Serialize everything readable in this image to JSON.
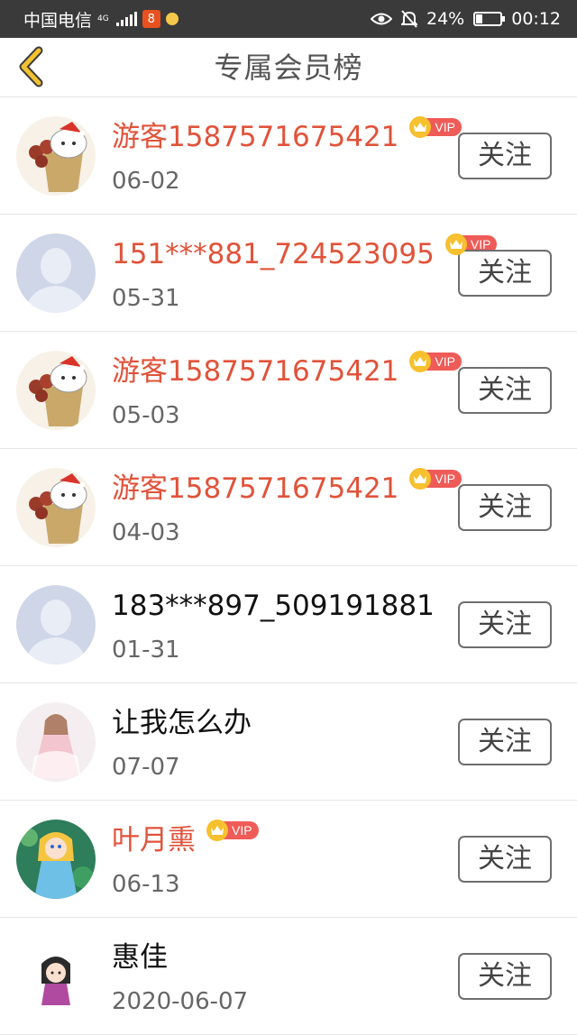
{
  "status_bar": {
    "carrier": "中国电信",
    "network_type": "4G",
    "app_badge_text": "8",
    "battery_percent": "24%",
    "battery_level": 0.24,
    "time": "00:12"
  },
  "header": {
    "title": "专属会员榜",
    "back_icon": "chevron-left-icon",
    "accent_color": "#f2c230"
  },
  "vip_badge_label": "VIP",
  "colors": {
    "vip_name": "#e0533a",
    "vip_badge": "#ef5b57",
    "vip_crown": "#f6c02e"
  },
  "members": [
    {
      "name": "游客1587571675421",
      "date": "06-02",
      "vip": true,
      "avatar": "cat-avatar",
      "follow_label": "关注"
    },
    {
      "name": "151***881_724523095",
      "date": "05-31",
      "vip": true,
      "avatar": "default-avatar",
      "follow_label": "关注"
    },
    {
      "name": "游客1587571675421",
      "date": "05-03",
      "vip": true,
      "avatar": "cat-avatar",
      "follow_label": "关注"
    },
    {
      "name": "游客1587571675421",
      "date": "04-03",
      "vip": true,
      "avatar": "cat-avatar",
      "follow_label": "关注"
    },
    {
      "name": "183***897_509191881",
      "date": "01-31",
      "vip": false,
      "avatar": "default-avatar",
      "follow_label": "关注"
    },
    {
      "name": "让我怎么办",
      "date": "07-07",
      "vip": false,
      "avatar": "anime-girl-avatar",
      "follow_label": "关注"
    },
    {
      "name": "叶月熏",
      "date": "06-13",
      "vip": true,
      "avatar": "anime-fairy-avatar",
      "follow_label": "关注"
    },
    {
      "name": "惠佳",
      "date": "2020-06-07",
      "vip": false,
      "avatar": "cartoon-girl-avatar",
      "follow_label": "关注"
    }
  ]
}
